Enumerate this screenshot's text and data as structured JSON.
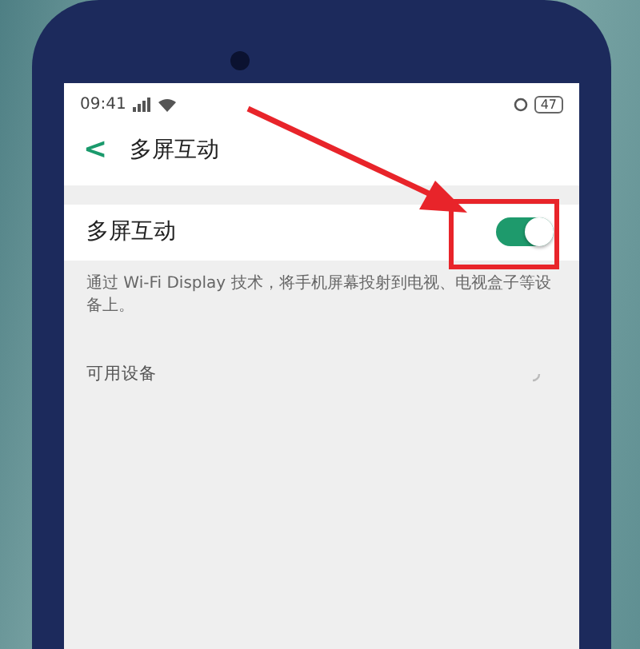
{
  "status_bar": {
    "time": "09:41",
    "battery": "47"
  },
  "header": {
    "back": "<",
    "title": "多屏互动"
  },
  "setting": {
    "label": "多屏互动",
    "on": true
  },
  "description": "通过 Wi-Fi Display 技术，将手机屏幕投射到电视、电视盒子等设备上。",
  "devices": {
    "label": "可用设备",
    "searching": true
  }
}
